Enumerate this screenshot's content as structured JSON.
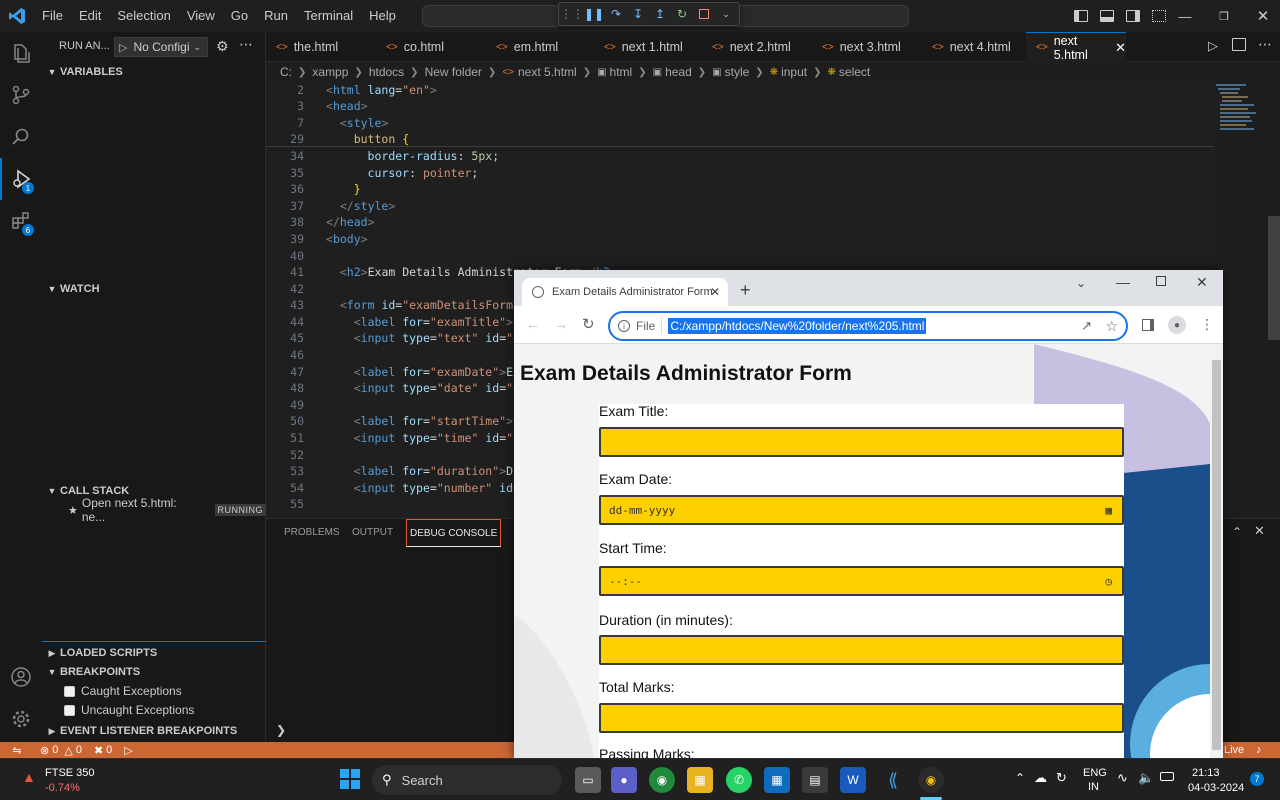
{
  "titlebar": {
    "menus": [
      "File",
      "Edit",
      "Selection",
      "View",
      "Go",
      "Run",
      "Terminal",
      "Help"
    ]
  },
  "sidebar": {
    "run_label": "RUN AN...",
    "config_label": "No Configi",
    "variables": "VARIABLES",
    "watch": "WATCH",
    "call_stack": "CALL STACK",
    "call_stack_item": "Open next 5.html: ne...",
    "call_stack_status": "RUNNING",
    "loaded_scripts": "LOADED SCRIPTS",
    "breakpoints": "BREAKPOINTS",
    "caught": "Caught Exceptions",
    "uncaught": "Uncaught Exceptions",
    "event_listener": "EVENT LISTENER BREAKPOINTS"
  },
  "activity_badges": {
    "run": "1",
    "extensions": "6"
  },
  "tabs": [
    "the.html",
    "co.html",
    "em.html",
    "next 1.html",
    "next 2.html",
    "next 3.html",
    "next 4.html",
    "next 5.html"
  ],
  "breadcrumb": [
    "C:",
    "xampp",
    "htdocs",
    "New folder",
    "next 5.html",
    "html",
    "head",
    "style",
    "input",
    "select"
  ],
  "editor": {
    "line_numbers": [
      "2",
      "3",
      "7",
      "29",
      "34",
      "35",
      "36",
      "37",
      "38",
      "39",
      "40",
      "41",
      "42",
      "43",
      "44",
      "45",
      "46",
      "47",
      "48",
      "49",
      "50",
      "51",
      "52",
      "53",
      "54",
      "55"
    ]
  },
  "panel": {
    "tabs": [
      "PROBLEMS",
      "OUTPUT",
      "DEBUG CONSOLE"
    ]
  },
  "statusbar": {
    "errors": "0",
    "warnings": "0",
    "ports": "0",
    "live": "Live"
  },
  "chrome": {
    "tab_title": "Exam Details Administrator Form",
    "file_label": "File",
    "url": "C:/xampp/htdocs/New%20folder/next%205.html",
    "page": {
      "heading": "Exam Details Administrator Form",
      "fields": [
        {
          "label": "Exam Title:",
          "value": ""
        },
        {
          "label": "Exam Date:",
          "value": "dd-mm-yyyy"
        },
        {
          "label": "Start Time:",
          "value": "--:--"
        },
        {
          "label": "Duration (in minutes):",
          "value": ""
        },
        {
          "label": "Total Marks:",
          "value": ""
        },
        {
          "label": "Passing Marks:",
          "value": ""
        }
      ]
    }
  },
  "taskbar": {
    "stock_name": "FTSE 350",
    "stock_change": "-0.74%",
    "search": "Search",
    "lang": "ENG",
    "region": "IN",
    "time": "21:13",
    "date": "04-03-2024",
    "notif": "7"
  },
  "colors": {
    "accent": "#0078d4",
    "debug_status": "#cc6633",
    "input_fill": "#ffd000"
  }
}
